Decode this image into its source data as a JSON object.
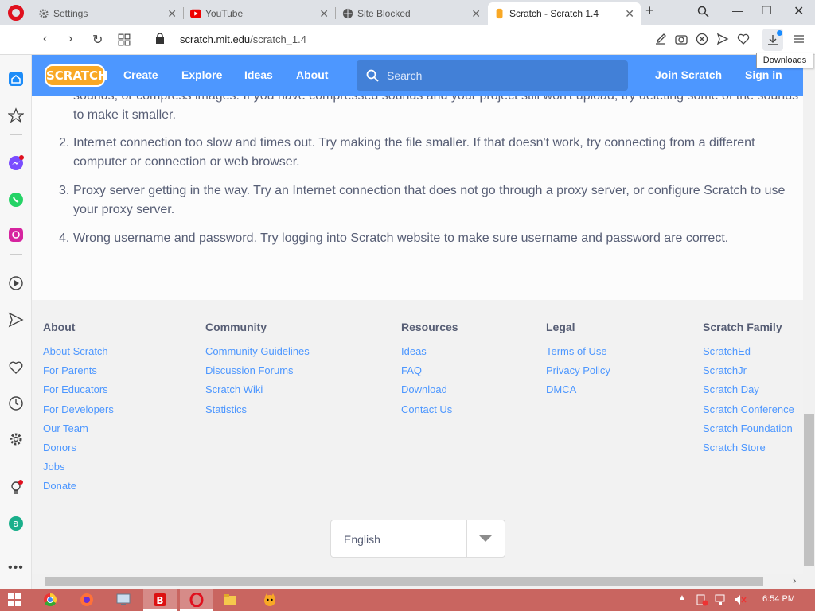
{
  "browser": {
    "tabs": [
      {
        "label": "Settings",
        "icon": "gear-icon",
        "active": false
      },
      {
        "label": "YouTube",
        "icon": "youtube-icon",
        "active": false
      },
      {
        "label": "Site Blocked",
        "icon": "globe-icon",
        "active": false
      },
      {
        "label": "Scratch - Scratch 1.4",
        "icon": "scratch-icon",
        "active": true
      }
    ],
    "url_host": "scratch.mit.edu",
    "url_path": "/scratch_1.4",
    "downloads_tooltip": "Downloads"
  },
  "scratch_nav": {
    "logo_text": "SCRATCH",
    "links": [
      "Create",
      "Explore",
      "Ideas",
      "About"
    ],
    "search_placeholder": "Search",
    "join": "Join Scratch",
    "signin": "Sign in"
  },
  "content": {
    "partial_text": "sounds, or compress images. If you have compressed sounds and your project still won't upload, try deleting some of the sounds to make it smaller.",
    "items": [
      {
        "num": "2.",
        "text": "Internet connection too slow and times out. Try making the file smaller. If that doesn't work, try connecting from a different computer or connection or web browser."
      },
      {
        "num": "3.",
        "text": "Proxy server getting in the way. Try an Internet connection that does not go through a proxy server, or configure Scratch to use your proxy server."
      },
      {
        "num": "4.",
        "text": "Wrong username and password. Try logging into Scratch website to make sure username and password are correct."
      }
    ]
  },
  "footer": {
    "columns": [
      {
        "heading": "About",
        "links": [
          "About Scratch",
          "For Parents",
          "For Educators",
          "For Developers",
          "Our Team",
          "Donors",
          "Jobs",
          "Donate"
        ]
      },
      {
        "heading": "Community",
        "links": [
          "Community Guidelines",
          "Discussion Forums",
          "Scratch Wiki",
          "Statistics"
        ]
      },
      {
        "heading": "Resources",
        "links": [
          "Ideas",
          "FAQ",
          "Download",
          "Contact Us"
        ]
      },
      {
        "heading": "Legal",
        "links": [
          "Terms of Use",
          "Privacy Policy",
          "DMCA"
        ]
      },
      {
        "heading": "Scratch Family",
        "links": [
          "ScratchEd",
          "ScratchJr",
          "Scratch Day",
          "Scratch Conference",
          "Scratch Foundation",
          "Scratch Store"
        ]
      }
    ],
    "language": "English"
  },
  "taskbar": {
    "clock": "6:54 PM"
  },
  "colors": {
    "scratch_blue": "#4d97ff",
    "taskbar": "#c96560",
    "text": "#575e75"
  }
}
